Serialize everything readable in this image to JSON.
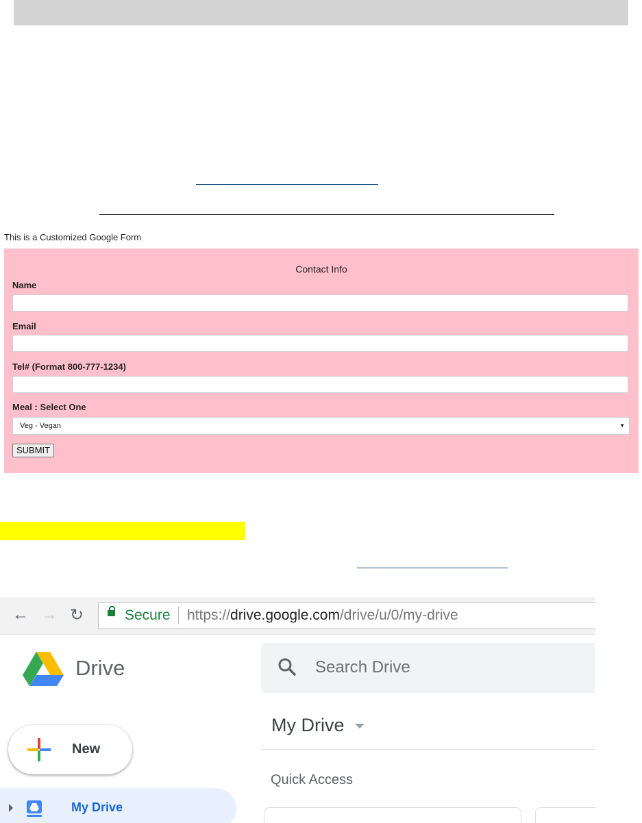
{
  "form": {
    "caption": "This is a Customized Google Form",
    "title": "Contact Info",
    "name_label": "Name",
    "email_label": "Email",
    "tel_label": "Tel# (Format 800-777-1234)",
    "meal_label": "Meal : Select One",
    "meal_selected": "Veg - Vegan",
    "submit_label": "SUBMIT",
    "background": "#ffc0cb"
  },
  "highlight_color": "#ffff00",
  "browser": {
    "secure_label": "Secure",
    "url_scheme": "https://",
    "url_domain": "drive.google.com",
    "url_path": "/drive/u/0/my-drive",
    "back_icon": "back-arrow-icon",
    "forward_icon": "forward-arrow-icon",
    "reload_icon": "reload-icon",
    "lock_icon": "lock-icon"
  },
  "drive": {
    "app_name": "Drive",
    "search_placeholder": "Search Drive",
    "page_title": "My Drive",
    "section_title": "Quick Access",
    "new_button": "New",
    "nav_selected": "My Drive"
  }
}
